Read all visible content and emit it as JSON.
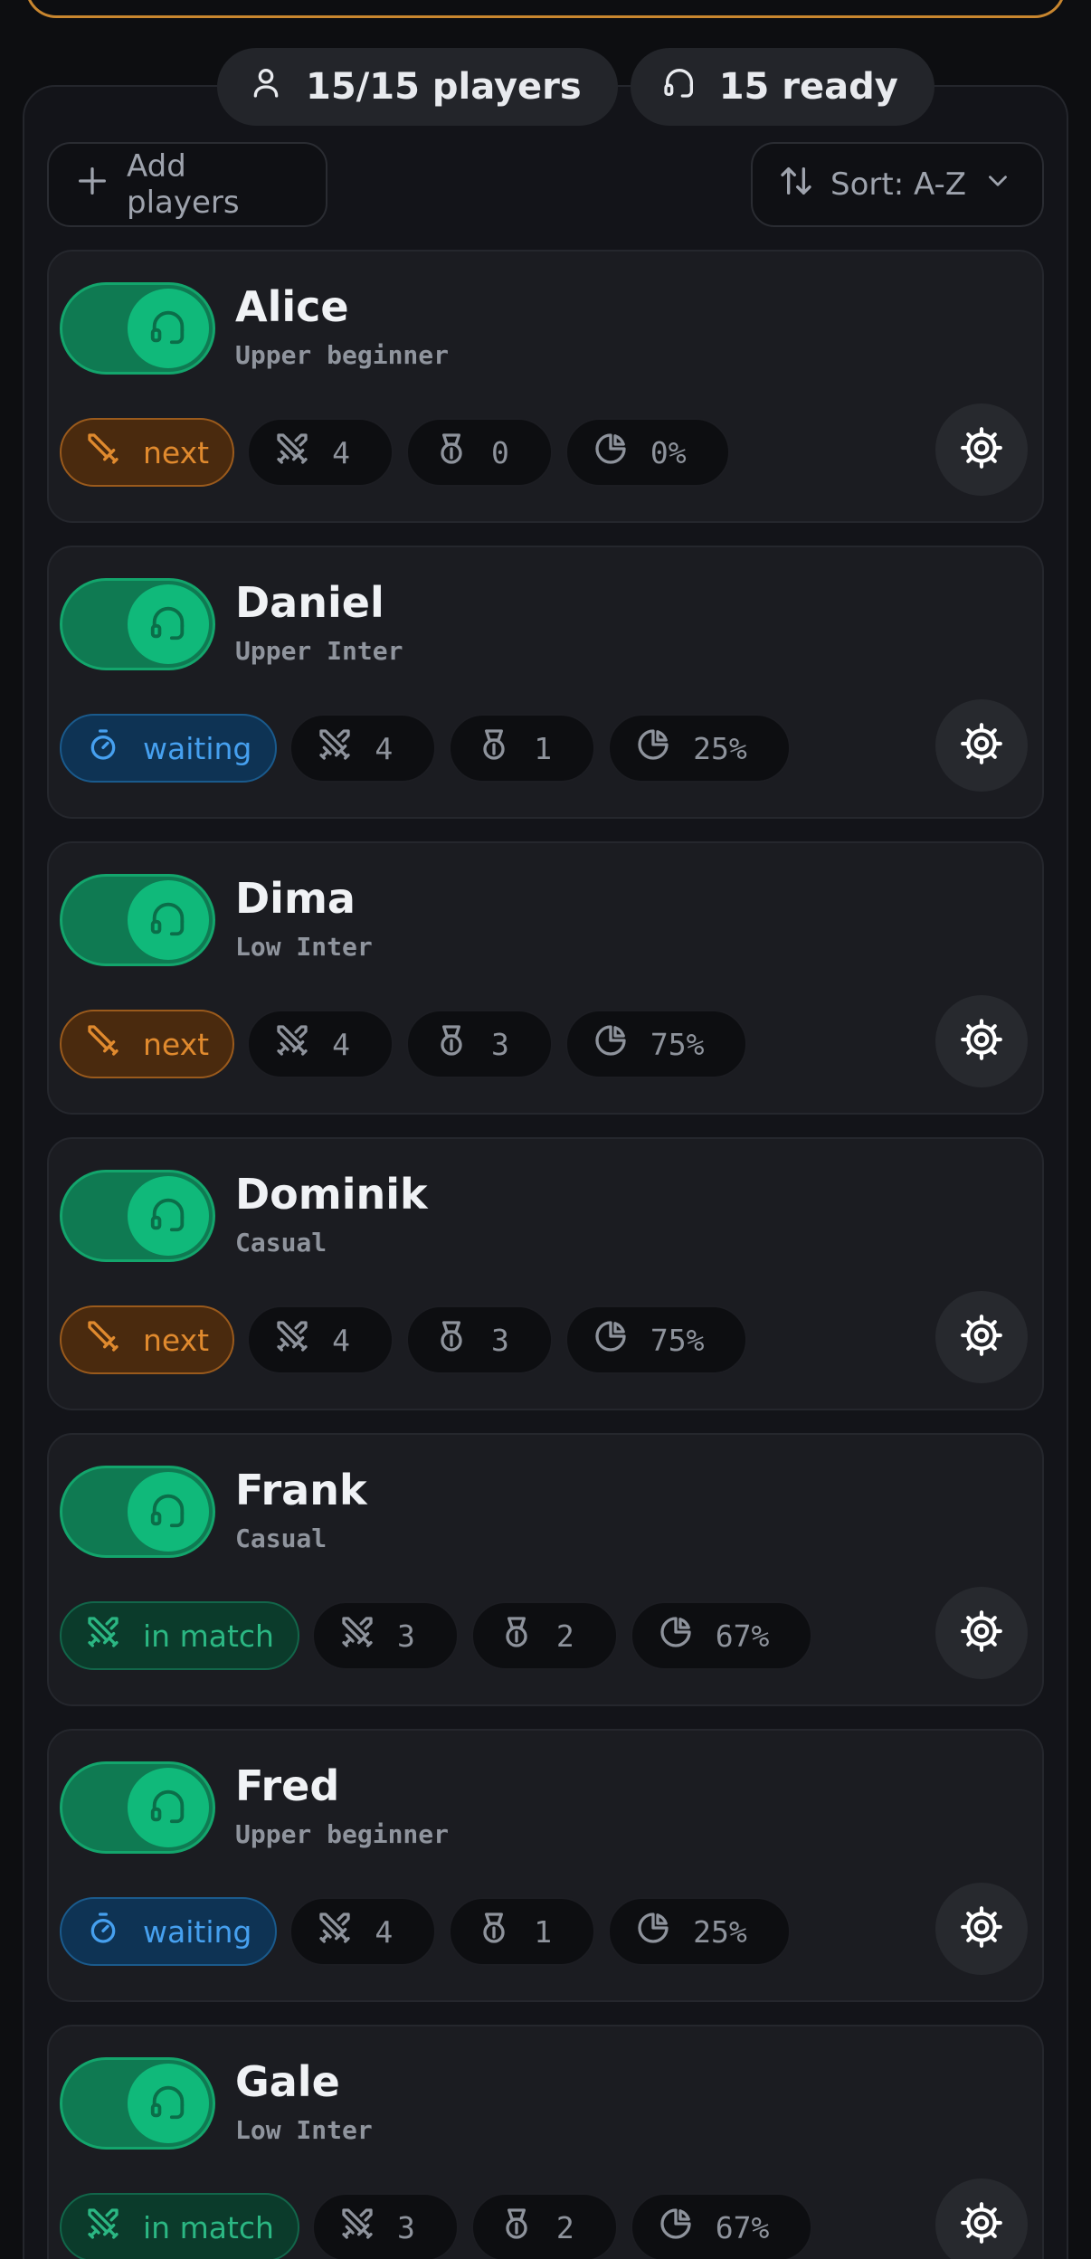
{
  "header": {
    "players_stat": "15/15 players",
    "ready_stat": "15 ready",
    "add_players_label": "Add players",
    "sort_label": "Sort: A-Z"
  },
  "colors": {
    "accent_green": "#10b97a",
    "status_next": "#e08a2e",
    "status_waiting": "#46a0ef",
    "status_in_match": "#2bb783"
  },
  "icons": {
    "players_stat": "user-icon",
    "ready_stat": "headphones-icon",
    "add": "plus-icon",
    "sort": "sort-arrows-icon",
    "sort_chevron": "chevron-down-icon",
    "toggle": "headphones-icon",
    "next": "sword-icon",
    "waiting": "stopwatch-icon",
    "in_match": "crossed-swords-icon",
    "matches": "crossed-swords-icon",
    "wins": "medal-icon",
    "win_rate": "pie-chart-icon",
    "settings": "gear-icon"
  },
  "players": [
    {
      "name": "Alice",
      "level": "Upper beginner",
      "status": "next",
      "status_label": "next",
      "matches": "4",
      "wins": "0",
      "win_rate": "0%",
      "ready": true
    },
    {
      "name": "Daniel",
      "level": "Upper Inter",
      "status": "waiting",
      "status_label": "waiting",
      "matches": "4",
      "wins": "1",
      "win_rate": "25%",
      "ready": true
    },
    {
      "name": "Dima",
      "level": "Low Inter",
      "status": "next",
      "status_label": "next",
      "matches": "4",
      "wins": "3",
      "win_rate": "75%",
      "ready": true
    },
    {
      "name": "Dominik",
      "level": "Casual",
      "status": "next",
      "status_label": "next",
      "matches": "4",
      "wins": "3",
      "win_rate": "75%",
      "ready": true
    },
    {
      "name": "Frank",
      "level": "Casual",
      "status": "in-match",
      "status_label": "in match",
      "matches": "3",
      "wins": "2",
      "win_rate": "67%",
      "ready": true
    },
    {
      "name": "Fred",
      "level": "Upper beginner",
      "status": "waiting",
      "status_label": "waiting",
      "matches": "4",
      "wins": "1",
      "win_rate": "25%",
      "ready": true
    },
    {
      "name": "Gale",
      "level": "Low Inter",
      "status": "in-match",
      "status_label": "in match",
      "matches": "3",
      "wins": "2",
      "win_rate": "67%",
      "ready": true
    }
  ]
}
